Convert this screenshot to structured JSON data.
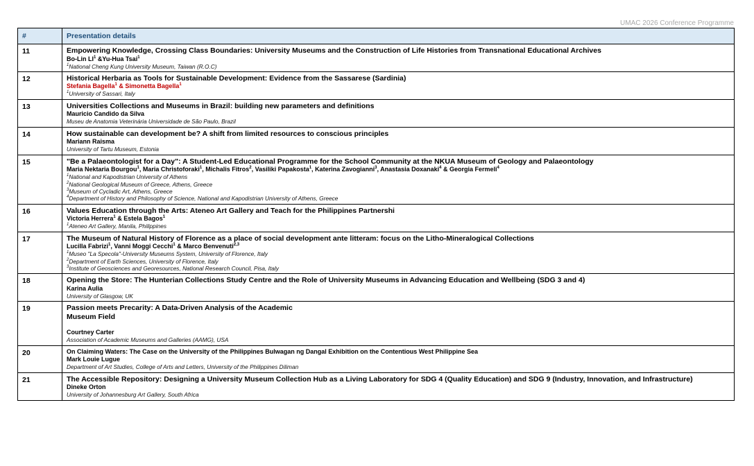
{
  "header": "UMAC 2026 Conference Programme",
  "table": {
    "col_num": "#",
    "col_details": "Presentation details"
  },
  "rows": [
    {
      "num": "11",
      "title": "Empowering Knowledge, Crossing Class Boundaries: University Museums and the Construction of Life Histories from Transnational Educational Archives",
      "authors": [
        {
          "name": "Bo-Lin LI",
          "sup": "1"
        },
        {
          "sep": " &"
        },
        {
          "name": "Yu-Hua Tsai",
          "sup": "1"
        }
      ],
      "affiliations": [
        {
          "sup": "1",
          "text": "National Cheng Kung University Museum, Taiwan (R.O.C)"
        }
      ]
    },
    {
      "num": "12",
      "title": "Historical Herbaria as Tools for Sustainable Development: Evidence from the Sassarese (Sardinia)",
      "authors_red": true,
      "authors": [
        {
          "name": "Stefania Bagella",
          "sup": "1"
        },
        {
          "sep": " & "
        },
        {
          "name": "Simonetta Bagella",
          "sup": "1"
        }
      ],
      "affiliations": [
        {
          "sup": "1",
          "text": "University of Sassari, Italy"
        }
      ]
    },
    {
      "num": "13",
      "title": "Universities Collections and Museums in Brazil: building new parameters and definitions",
      "authors": [
        {
          "name": "Mauricio Candido da Silva"
        }
      ],
      "affiliations": [
        {
          "text": "Museu de Anatomia Veterinária Universidade de São Paulo, Brazil"
        }
      ]
    },
    {
      "num": "14",
      "title": "How sustainable can development be? A shift from limited resources to conscious principles",
      "authors": [
        {
          "name": "Mariann Raisma"
        }
      ],
      "affiliations": [
        {
          "text": "University of Tartu Museum, Estonia"
        }
      ]
    },
    {
      "num": "15",
      "title": "\"Be a Palaeontologist for a Day\": A Student-Led Educational Programme for the School Community at the NKUA Museum of Geology and Palaeontology",
      "authors": [
        {
          "name": "Maria Nektaria Bourgou",
          "sup": "1"
        },
        {
          "sep": ", "
        },
        {
          "name": "Maria Christoforaki",
          "sup": "1"
        },
        {
          "sep": ", "
        },
        {
          "name": "Michalis Fitros",
          "sup": "2"
        },
        {
          "sep": ", "
        },
        {
          "name": "Vasiliki Papakosta",
          "sup": "1"
        },
        {
          "sep": ", "
        },
        {
          "name": "Katerina Zavogianni",
          "sup": "3"
        },
        {
          "sep": ", "
        },
        {
          "name": "Anastasia Doxanaki",
          "sup": "4"
        },
        {
          "sep": " & "
        },
        {
          "name": "Georgia Fermeli",
          "sup": "4"
        }
      ],
      "affiliations": [
        {
          "sup": "1",
          "text": "National and Kapodistrian University of Athens"
        },
        {
          "sup": "2",
          "text": "National Geological Museum of Greece, Athens, Greece"
        },
        {
          "sup": "3",
          "text": "Museum of Cycladic Art, Athens, Greece"
        },
        {
          "sup": "4",
          "text": "Department of History and Philosophy of Science, National and Kapodistrian University of Athens, Greece"
        }
      ]
    },
    {
      "num": "16",
      "title": "Values Education through the Arts: Ateneo Art Gallery and Teach for the Philippines Partnershi",
      "authors": [
        {
          "name": "Victoria Herrera",
          "sup": "1"
        },
        {
          "sep": " & "
        },
        {
          "name": "Estela Bagos",
          "sup": "1"
        }
      ],
      "affiliations": [
        {
          "sup": "1",
          "text": "Ateneo Art Gallery, Manila, Philippines"
        }
      ]
    },
    {
      "num": "17",
      "title": "The Museum of Natural History of Florence as a place of social development ante litteram: focus on the Litho-Mineralogical Collections",
      "authors": [
        {
          "name": "Lucilla Fabrizi",
          "sup": "1"
        },
        {
          "sep": ", "
        },
        {
          "name": "Vanni Moggi Cecchi",
          "sup": "1"
        },
        {
          "sep": " & "
        },
        {
          "name": "Marco Benvenuti",
          "sup": "2,3"
        }
      ],
      "affiliations": [
        {
          "sup": "1",
          "text": "Museo \"La Specola\"-University Museums System, University of Florence, Italy"
        },
        {
          "sup": "2",
          "text": "Department of Earth Sciences, University of Florence, Italy"
        },
        {
          "sup": "3",
          "text": "Institute of Geosciences and Georesources, National Research Council, Pisa, Italy"
        }
      ]
    },
    {
      "num": "18",
      "title": "Opening the Store: The Hunterian Collections Study Centre and the Role of University Museums in Advancing Education and Wellbeing (SDG 3 and 4)",
      "authors": [
        {
          "name": "Karina Aulia"
        }
      ],
      "affiliations": [
        {
          "text": "University of Glasgow, UK"
        }
      ]
    },
    {
      "num": "19",
      "title": "Passion meets Precarity: A Data-Driven Analysis of the Academic",
      "title_line2": "Museum Field",
      "gap_before_authors": true,
      "authors": [
        {
          "name": "Courtney Carter"
        }
      ],
      "affiliations": [
        {
          "text": "Association of Academic Museums and Galleries (AAMG), USA"
        }
      ]
    },
    {
      "num": "20",
      "title_small": true,
      "title": "On Claiming Waters: The Case on the University of the Philippines Bulwagan ng Dangal Exhibition on the Contentious West Philippine Sea",
      "authors": [
        {
          "name": "Mark Louie Lugue"
        }
      ],
      "affiliations": [
        {
          "text": "Department of Art Studies, College of Arts and Letters, University of the Philippines Diliman"
        }
      ]
    },
    {
      "num": "21",
      "title": "The Accessible Repository: Designing a University Museum Collection Hub as a Living Laboratory for SDG 4 (Quality Education) and SDG 9 (Industry, Innovation, and Infrastructure)",
      "authors": [
        {
          "name": "Dineke Orton"
        }
      ],
      "affiliations": [
        {
          "text": "University of Johannesburg Art Gallery, South Africa"
        }
      ]
    }
  ]
}
